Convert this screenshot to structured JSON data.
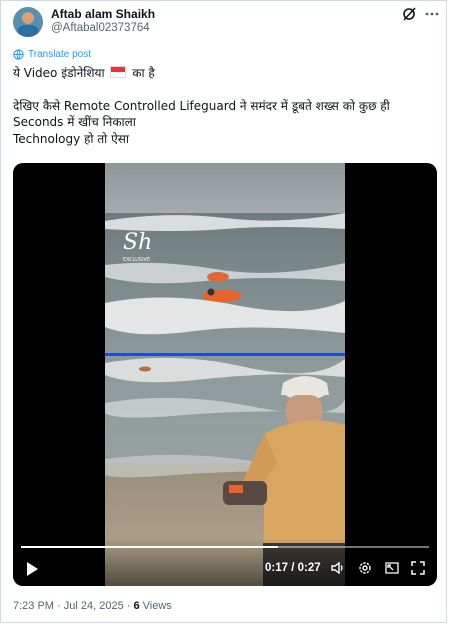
{
  "author": {
    "name": "Aftab alam Shaikh",
    "handle": "@Aftabal02373764"
  },
  "translate_label": "Translate post",
  "tweet": {
    "line1_a": "ये Video इंडोनेशिया",
    "line1_b": "का है",
    "line2": "देखिए कैसे Remote Controlled Lifeguard ने समंदर में डूबते शख्स को कुछ ही",
    "line3": "Seconds में खींच निकाला",
    "line4": "Technology हो तो ऐसा"
  },
  "video": {
    "time": "0:17 / 0:27",
    "progress": 0.63,
    "watermark_letters": "Sh",
    "watermark_sub": "EXCLUSIVE"
  },
  "footer": {
    "time": "7:23 PM",
    "date": "Jul 24, 2025",
    "views_count": "6",
    "views_label": "Views"
  },
  "icons": [
    "avatar",
    "grok-icon",
    "more-icon",
    "translate-icon",
    "indonesia-flag-icon",
    "play-icon",
    "volume-icon",
    "settings-icon",
    "pip-icon",
    "fullscreen-icon"
  ],
  "colors": {
    "accent": "#1d9bf0",
    "muted": "#536471",
    "flag_red": "#e2323a"
  }
}
